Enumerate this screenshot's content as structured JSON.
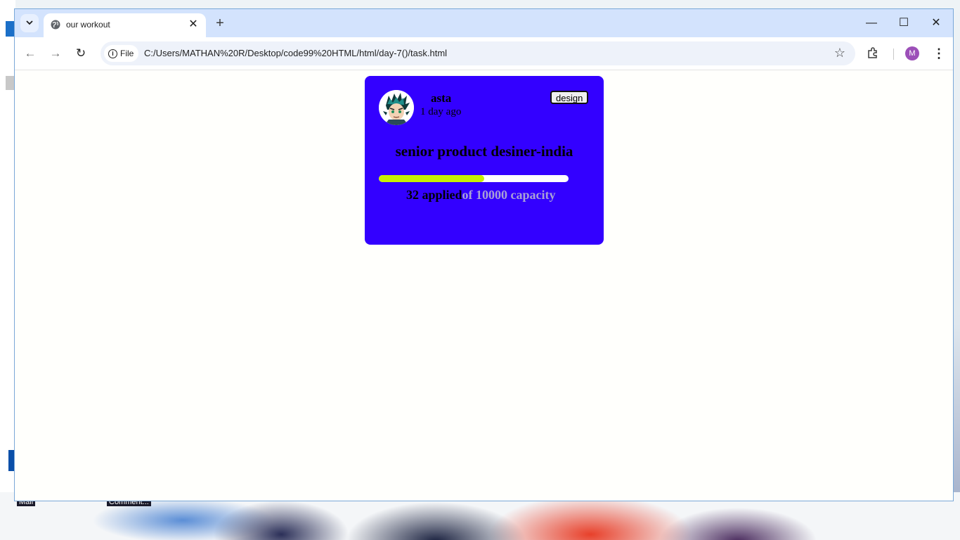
{
  "browser": {
    "tab": {
      "title": "our workout"
    },
    "address": {
      "chip_label": "File",
      "url": "C:/Users/MATHAN%20R/Desktop/code99%20HTML/html/day-7()/task.html"
    },
    "profile_initial": "M"
  },
  "desktop": {
    "taskbar_labels": [
      "Mail",
      "Comment..."
    ]
  },
  "card": {
    "username": "asta",
    "time_ago": "1 day ago",
    "tag": "design",
    "job_title": "senior product desiner-india",
    "applied_text": "32 applied",
    "capacity_text": "of 10000 capacity",
    "progress_fraction": 0.556,
    "colors": {
      "background": "#3300ff",
      "progress_fill": "#c7f000",
      "progress_track": "#ffffff",
      "capacity_text": "#a9a1d6"
    }
  }
}
